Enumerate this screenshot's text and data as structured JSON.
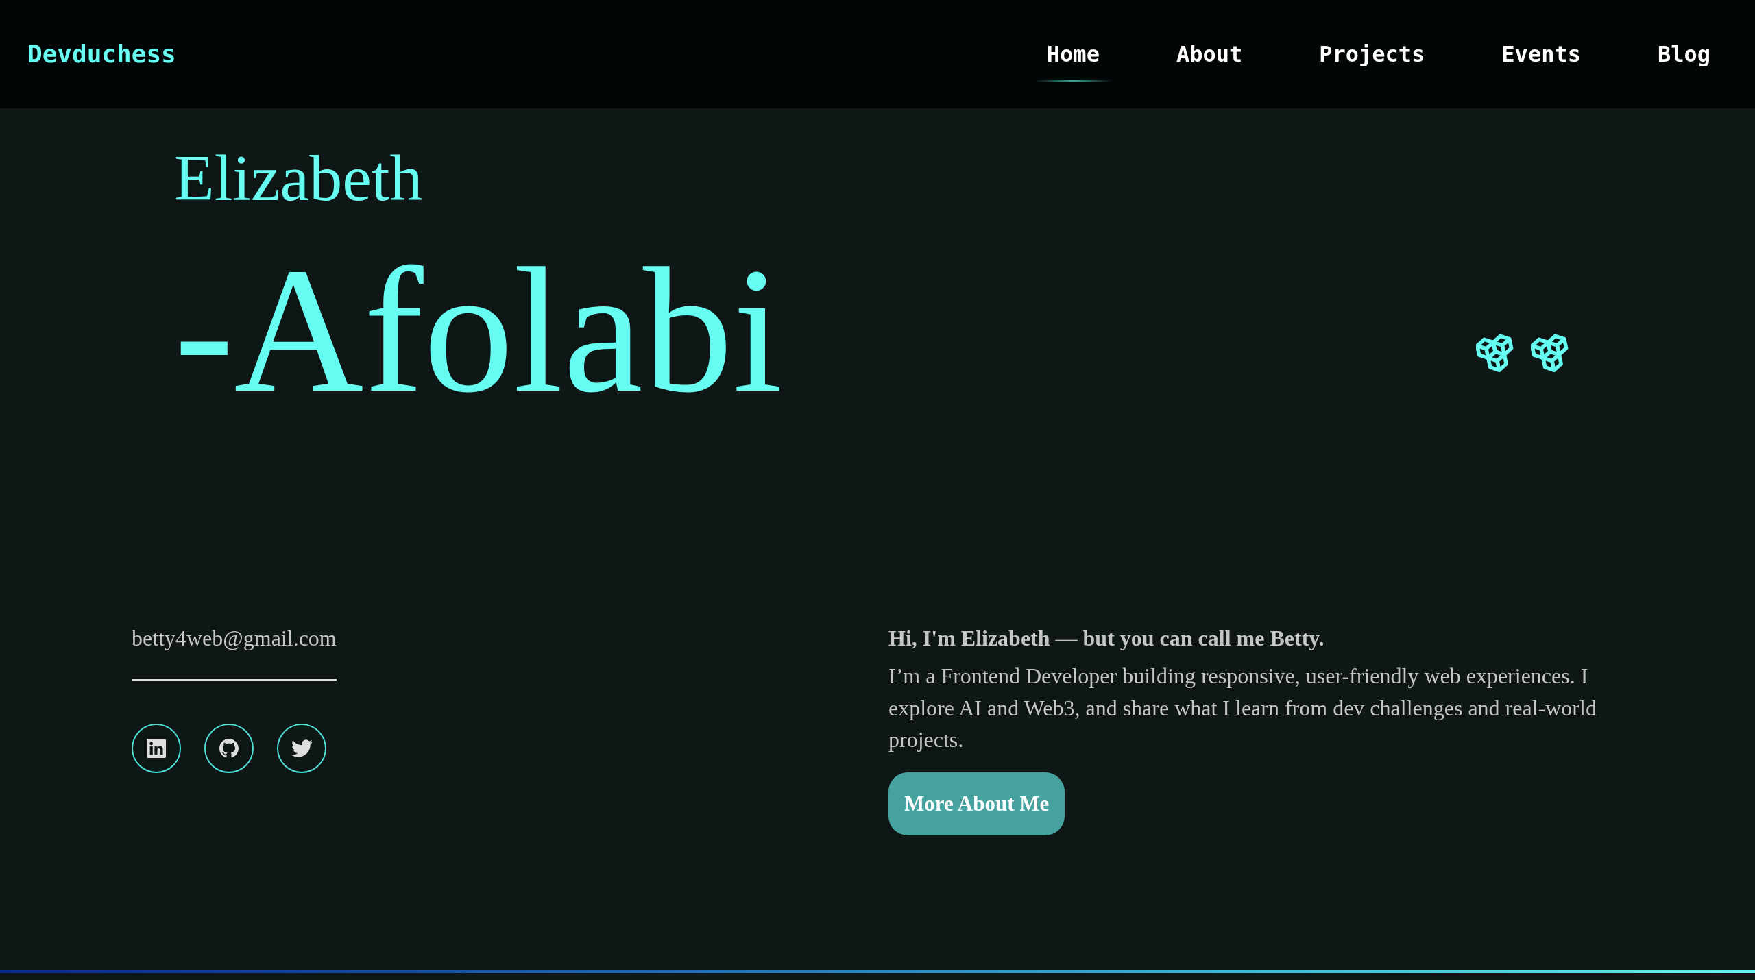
{
  "nav": {
    "logo": "Devduchess",
    "links": [
      {
        "label": "Home",
        "selected": true
      },
      {
        "label": "About",
        "selected": false
      },
      {
        "label": "Projects",
        "selected": false
      },
      {
        "label": "Events",
        "selected": false
      },
      {
        "label": "Blog",
        "selected": false
      }
    ]
  },
  "hero": {
    "first_name": "Elizabeth",
    "last_name": "-Afolabi"
  },
  "contact": {
    "email": "betty4web@gmail.com",
    "socials": [
      {
        "kind": "linkedin"
      },
      {
        "kind": "github"
      },
      {
        "kind": "twitter"
      }
    ]
  },
  "about": {
    "greeting": "Hi, I'm Elizabeth — but you can call me Betty.",
    "text": "I’m a Frontend Developer building responsive, user-friendly web experiences. I explore AI and Web3, and share what I learn from dev challenges and real-world projects.",
    "button": "More About Me"
  }
}
